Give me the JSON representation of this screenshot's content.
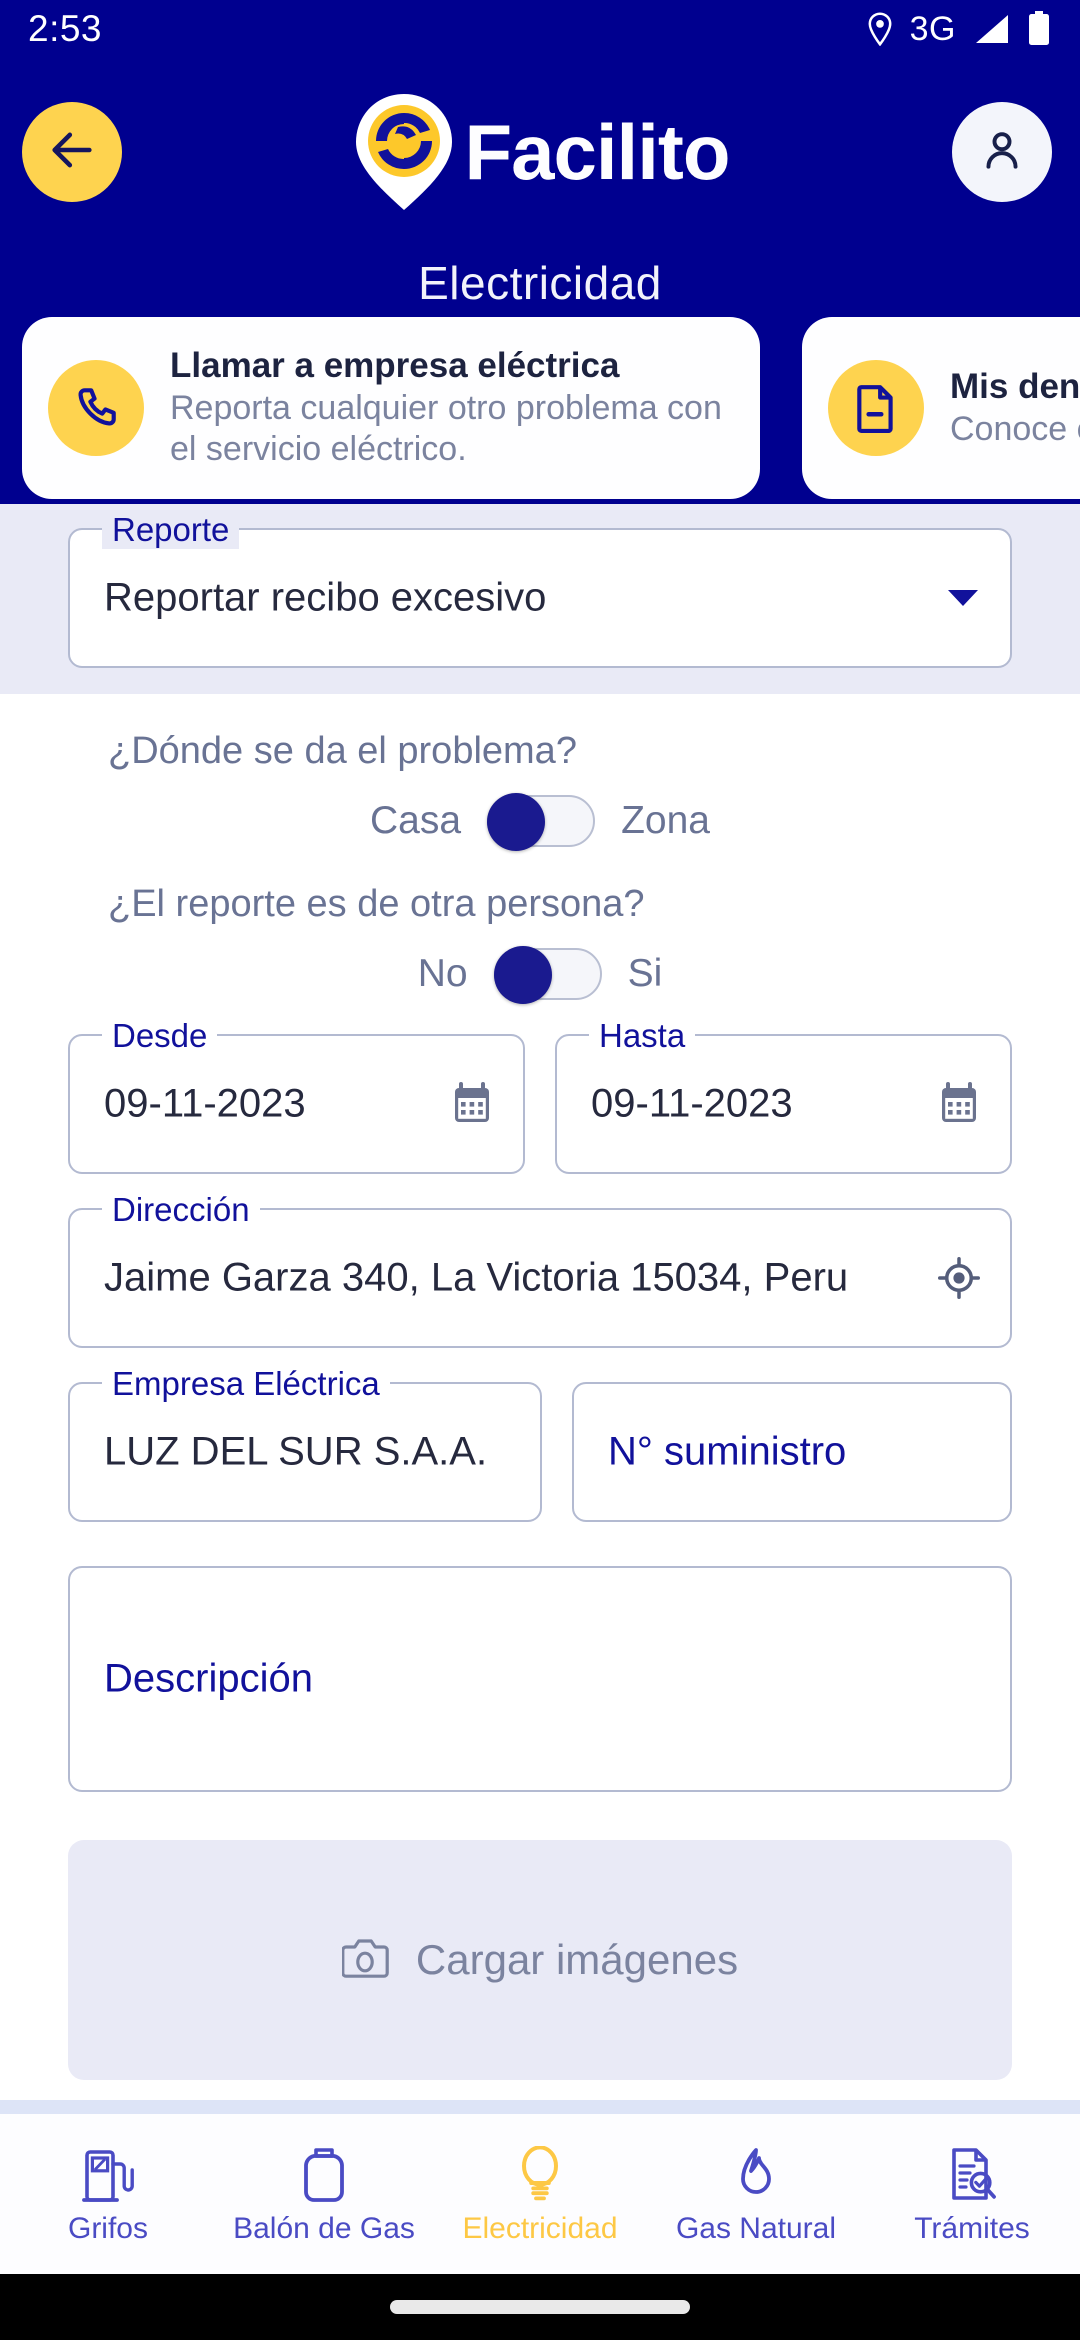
{
  "status_bar": {
    "time": "2:53",
    "network": "3G",
    "icons": [
      "location-pin-icon",
      "signal-icon",
      "battery-icon"
    ]
  },
  "header": {
    "brand_name": "Facilito",
    "page_title": "Electricidad",
    "back_icon": "arrow-left-icon",
    "profile_icon": "person-icon",
    "logo_icon": "facilito-logo-icon",
    "colors": {
      "background": "#00008f",
      "accent_yellow": "#fed34f"
    }
  },
  "action_cards": [
    {
      "icon": "phone-icon",
      "title": "Llamar a empresa eléctrica",
      "subtitle": "Reporta cualquier otro problema con el servicio eléctrico."
    },
    {
      "icon": "document-minus-icon",
      "title": "Mis denun",
      "subtitle": "Conoce el"
    }
  ],
  "form": {
    "report_select": {
      "label": "Reporte",
      "value": "Reportar recibo excesivo",
      "chevron_icon": "chevron-down-icon"
    },
    "question_location": {
      "text": "¿Dónde se da el problema?",
      "option_left": "Casa",
      "option_right": "Zona",
      "selected": "Casa"
    },
    "question_other_person": {
      "text": "¿El reporte es de otra persona?",
      "option_left": "No",
      "option_right": "Si",
      "selected": "No"
    },
    "date_from": {
      "label": "Desde",
      "value": "09-11-2023",
      "icon": "calendar-icon"
    },
    "date_to": {
      "label": "Hasta",
      "value": "09-11-2023",
      "icon": "calendar-icon"
    },
    "address": {
      "label": "Dirección",
      "value": "Jaime Garza 340, La Victoria 15034, Peru",
      "icon": "gps-target-icon"
    },
    "company": {
      "label": "Empresa Eléctrica",
      "value": "LUZ DEL SUR S.A.A."
    },
    "supply_number": {
      "placeholder": "N° suministro",
      "value": ""
    },
    "description": {
      "placeholder": "Descripción",
      "value": ""
    },
    "upload": {
      "label": "Cargar imágenes",
      "icon": "camera-icon"
    }
  },
  "bottom_nav": {
    "active": "Electricidad",
    "items": [
      {
        "label": "Grifos",
        "icon": "fuel-pump-icon"
      },
      {
        "label": "Balón de Gas",
        "icon": "gas-cylinder-icon"
      },
      {
        "label": "Electricidad",
        "icon": "lightbulb-icon"
      },
      {
        "label": "Gas Natural",
        "icon": "flame-icon"
      },
      {
        "label": "Trámites",
        "icon": "document-search-icon"
      }
    ]
  }
}
